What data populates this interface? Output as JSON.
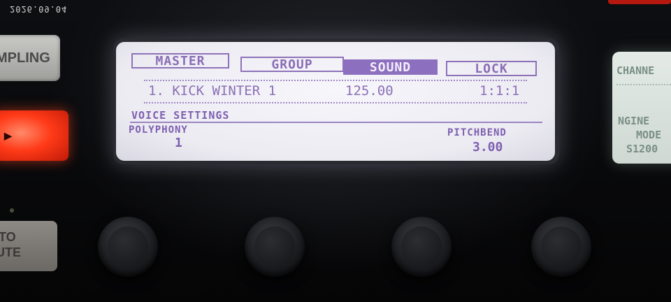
{
  "timestamp": "2026.09.04",
  "hardware_buttons": {
    "sampling": "MPLING",
    "mute_line1": "TO",
    "mute_line2": "UTE"
  },
  "display": {
    "tabs": [
      {
        "label": "MASTER",
        "selected": false
      },
      {
        "label": "GROUP",
        "selected": false
      },
      {
        "label": "SOUND",
        "selected": true
      },
      {
        "label": "LOCK",
        "selected": false
      }
    ],
    "sound": {
      "name": "1. KICK WINTER 1",
      "tempo": "125.00",
      "position": "1:1:1"
    },
    "section_title": "VOICE SETTINGS",
    "polyphony": {
      "label": "POLYPHONY",
      "value": "1"
    },
    "pitchbend": {
      "label": "PITCHBEND",
      "value": "3.00"
    }
  },
  "right_display": {
    "line1": "CHANNE",
    "line2": "NGINE",
    "line3": "MODE",
    "line4": "S1200"
  },
  "colors": {
    "lcd_background": "#f0eff5",
    "lcd_text": "#7d5fb0",
    "play_button": "#ff3a18"
  }
}
